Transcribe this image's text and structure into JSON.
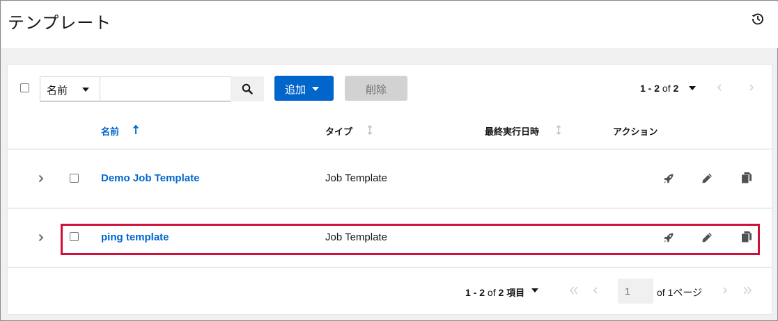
{
  "page": {
    "title": "テンプレート"
  },
  "toolbar": {
    "filter_field": "名前",
    "search_value": "",
    "add_label": "追加",
    "delete_label": "削除",
    "pagination": {
      "range": "1 - 2",
      "of": "of",
      "total": "2"
    }
  },
  "table": {
    "columns": [
      {
        "label": "名前",
        "sorted": "ascending"
      },
      {
        "label": "タイプ"
      },
      {
        "label": "最終実行日時"
      },
      {
        "label": "アクション"
      }
    ],
    "rows": [
      {
        "name": "Demo Job Template",
        "type": "Job Template",
        "last_run": ""
      },
      {
        "name": "ping template",
        "type": "Job Template",
        "last_run": "",
        "highlighted": true
      }
    ]
  },
  "footer": {
    "range": "1 - 2",
    "of": "of",
    "total": "2",
    "unit": "項目",
    "page_value": "1",
    "of_pages_prefix": "of",
    "of_pages_count": "1",
    "pages_suffix": "ページ"
  },
  "colors": {
    "link": "#0066cc",
    "primary": "#0066cc",
    "highlight": "#d0103a",
    "disabled": "#d2d2d2"
  },
  "icons": [
    "history-icon",
    "caret-down-icon",
    "search-icon",
    "chevron-left-icon",
    "chevron-right-icon",
    "sort-asc-icon",
    "sort-icon",
    "expand-icon",
    "rocket-icon",
    "pencil-icon",
    "copy-icon",
    "first-page-icon",
    "last-page-icon"
  ]
}
